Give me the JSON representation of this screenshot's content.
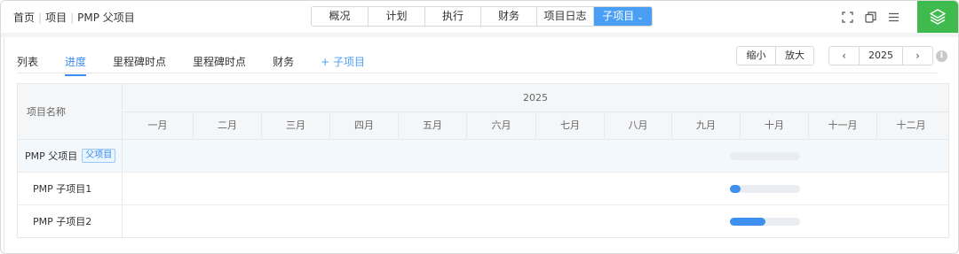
{
  "breadcrumb": [
    "首页",
    "项目",
    "PMP 父项目"
  ],
  "nav_tabs": [
    {
      "label": "概况",
      "active": false
    },
    {
      "label": "计划",
      "active": false
    },
    {
      "label": "执行",
      "active": false
    },
    {
      "label": "财务",
      "active": false
    },
    {
      "label": "项目日志",
      "active": false
    },
    {
      "label": "子项目",
      "active": true
    }
  ],
  "top_icons": [
    "fullscreen-icon",
    "copy-icon",
    "menu-icon",
    "layers-icon"
  ],
  "subtabs": [
    {
      "label": "列表",
      "active": false
    },
    {
      "label": "进度",
      "active": true
    },
    {
      "label": "里程碑时点",
      "active": false
    },
    {
      "label": "里程碑时点",
      "active": false
    },
    {
      "label": "财务",
      "active": false
    }
  ],
  "add_subproject_label": "+ 子项目",
  "zoom": {
    "out_label": "缩小",
    "in_label": "放大"
  },
  "year_nav": {
    "prev": "‹",
    "year": "2025",
    "next": "›"
  },
  "gantt": {
    "name_header": "项目名称",
    "year": "2025",
    "months": [
      "一月",
      "二月",
      "三月",
      "四月",
      "五月",
      "六月",
      "七月",
      "八月",
      "九月",
      "十月",
      "十一月",
      "十二月"
    ],
    "rows": [
      {
        "name": "PMP 父项目",
        "tag": "父项目",
        "progress": 0
      },
      {
        "name": "PMP 子项目1",
        "tag": "",
        "progress": 0.15
      },
      {
        "name": "PMP 子项目2",
        "tag": "",
        "progress": 0.5
      }
    ]
  },
  "colors": {
    "accent": "#4a9ff5",
    "bar": "#3d8ff0",
    "stack_button": "#3fba4c"
  }
}
